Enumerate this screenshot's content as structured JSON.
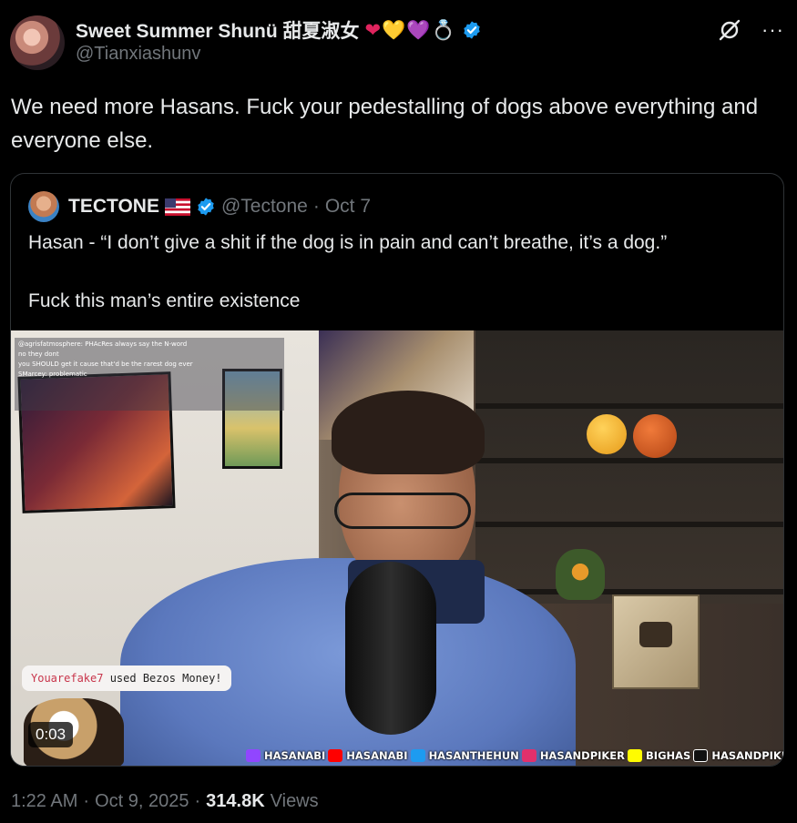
{
  "author": {
    "name": "Sweet Summer Shunü 甜夏淑女",
    "emojis": [
      "❤",
      "💛",
      "💜",
      "💍"
    ],
    "handle": "@Tianxiashunv",
    "verified": true
  },
  "actions": {
    "grok_icon": "grok-icon",
    "more_icon": "more-icon",
    "more_glyph": "···"
  },
  "tweet": {
    "text": "We need more Hasans. Fuck your pedestalling of dogs above everything and everyone else."
  },
  "quote": {
    "name": "TECTONE",
    "flag": "us-flag",
    "handle": "@Tectone",
    "separator": "·",
    "date": "Oct 7",
    "line1": "Hasan - “I don’t give a shit if the dog is in pain and can’t breathe, it’s a dog.”",
    "line2": "Fuck this man’s entire existence",
    "video": {
      "timer": "0:03",
      "chat": [
        "@agrisfatmosphere: PHAcRes always say the N-word",
        "no they dont",
        "you SHOULD get it cause that'd be the rarest dog ever",
        "SMarcey:  problematic"
      ],
      "alert_user": "Youarefake7",
      "alert_text": " used Bezos Money!",
      "socials": [
        "HASANABI",
        "HASANABI",
        "HASANTHEHUN",
        "HASANDPIKER",
        "BIGHAS",
        "HASANDPIKER"
      ]
    }
  },
  "footer": {
    "time": "1:22 AM",
    "sep1": "·",
    "date": "Oct 9, 2025",
    "sep2": "·",
    "views_count": "314.8K",
    "views_label": "Views"
  },
  "colors": {
    "verified": "#1d9bf0",
    "muted": "#71767b",
    "text": "#e7e9ea"
  }
}
